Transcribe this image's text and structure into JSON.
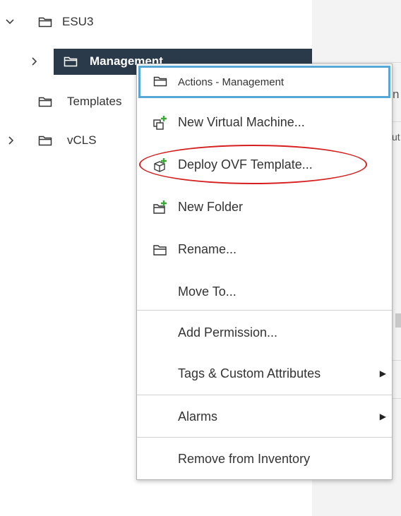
{
  "tree": {
    "items": [
      {
        "label": "ESU3",
        "expander": "chevron-down"
      },
      {
        "label": "Management",
        "expander": "chevron-right",
        "selected": true
      },
      {
        "label": "Templates",
        "expander": "none"
      },
      {
        "label": "vCLS",
        "expander": "chevron-right"
      }
    ]
  },
  "context_menu": {
    "header": "Actions - Management",
    "items": [
      {
        "label": "New Virtual Machine...",
        "icon": "new-vm-icon"
      },
      {
        "label": "Deploy OVF Template...",
        "icon": "deploy-ovf-icon"
      },
      {
        "label": "New Folder",
        "icon": "new-folder-icon"
      },
      {
        "label": "Rename...",
        "icon": "folder-icon"
      },
      {
        "label": "Move To...",
        "icon": ""
      },
      {
        "label": "Add Permission...",
        "icon": ""
      },
      {
        "label": "Tags & Custom Attributes",
        "icon": "",
        "submenu": true
      },
      {
        "label": "Alarms",
        "icon": "",
        "submenu": true
      },
      {
        "label": "Remove from Inventory",
        "icon": ""
      }
    ]
  },
  "right_pane": {
    "partial_texts": [
      "n",
      "ut"
    ]
  },
  "colors": {
    "selected_bg": "#2b3a4a",
    "header_border": "#56a6d6",
    "annotation_red": "#d62020",
    "plus_green": "#3aaa35"
  }
}
